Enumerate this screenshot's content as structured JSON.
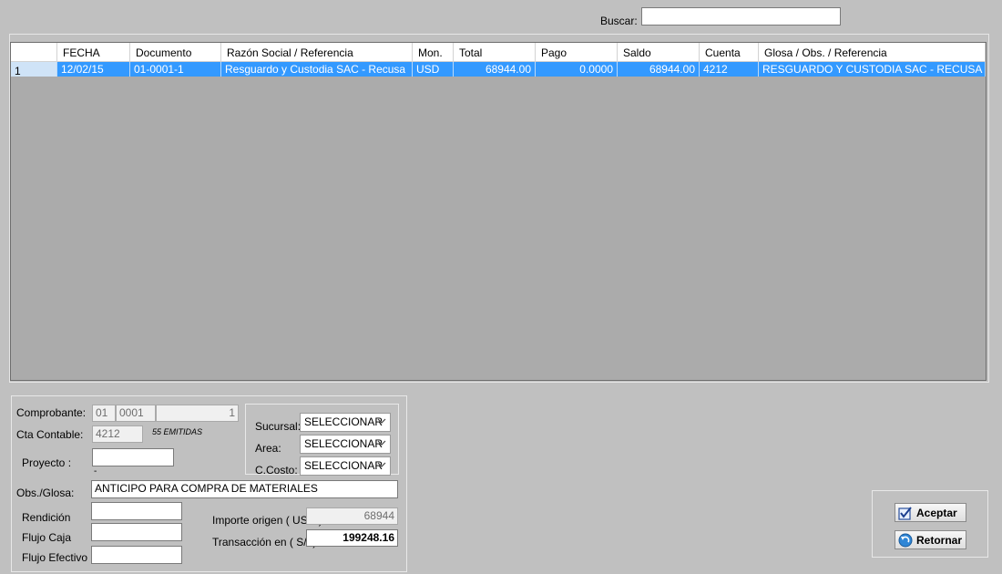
{
  "search": {
    "label": "Buscar:",
    "value": ""
  },
  "table": {
    "columns": [
      "FECHA",
      "Documento",
      "Razón Social / Referencia",
      "Mon.",
      "Total",
      "Pago",
      "Saldo",
      "Cuenta",
      "Glosa / Obs. / Referencia"
    ],
    "rows": [
      [
        "1",
        "12/02/15",
        "01-0001-1",
        "Resguardo y Custodia SAC - Recusa",
        "USD",
        "68944.00",
        "0.0000",
        "68944.00",
        "4212",
        "RESGUARDO Y CUSTODIA SAC - RECUSA"
      ]
    ]
  },
  "form": {
    "comprobante_label": "Comprobante:",
    "comprobante_serie": "01",
    "comprobante_numero": "0001",
    "comprobante_correlativo": "1",
    "cta_contable_label": "Cta Contable:",
    "cta_contable_value": "4212",
    "emitidas_text": "55 EMITIDAS",
    "proyecto_label": "Proyecto :",
    "proyecto_value": "",
    "proyecto_dash": "-",
    "obs_label": "Obs./Glosa:",
    "obs_value": "ANTICIPO PARA COMPRA DE MATERIALES",
    "rendicion_label": "Rendición",
    "rendicion_value": "",
    "flujo_caja_label": "Flujo Caja",
    "flujo_caja_value": "",
    "flujo_efectivo_label": "Flujo Efectivo",
    "flujo_efectivo_value": "",
    "importe_origen_label": "Importe origen ( USD )",
    "importe_origen_value": "68944",
    "transaccion_label": "Transacción en ( S/. )",
    "transaccion_value": "199248.16"
  },
  "branch": {
    "sucursal_label": "Sucursal:",
    "sucursal_value": "SELECCIONAR",
    "area_label": "Area:",
    "area_value": "SELECCIONAR",
    "ccosto_label": "C.Costo:",
    "ccosto_value": "SELECCIONAR"
  },
  "buttons": {
    "aceptar": "Aceptar",
    "retornar": "Retornar"
  },
  "icons": {
    "aceptar": "checkbox-check-icon",
    "retornar": "return-arrow-icon",
    "dropdown": "chevron-down-icon"
  },
  "colors": {
    "selected_row": "#3399ff",
    "window_bg": "#c0c0c0",
    "grid_bg": "#ababab"
  }
}
